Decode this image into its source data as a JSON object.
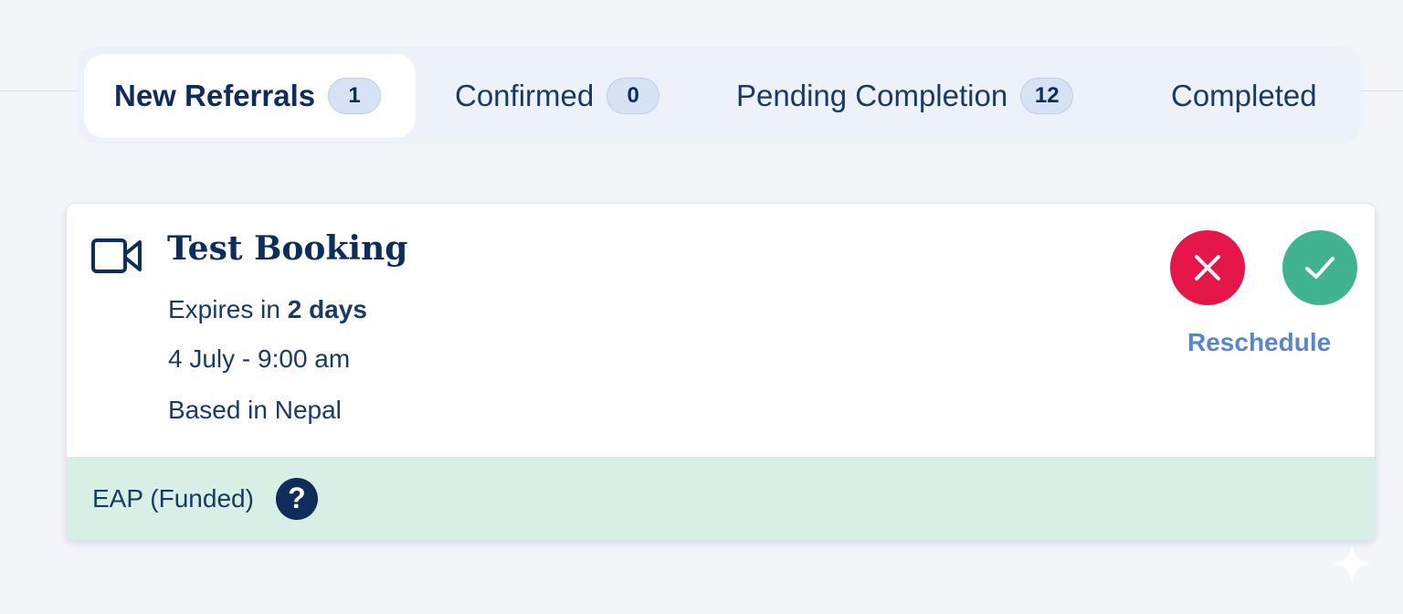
{
  "tabs": [
    {
      "label": "New Referrals",
      "count": "1",
      "active": true
    },
    {
      "label": "Confirmed",
      "count": "0",
      "active": false
    },
    {
      "label": "Pending Completion",
      "count": "12",
      "active": false
    },
    {
      "label": "Completed",
      "active": false
    }
  ],
  "booking": {
    "icon": "video-camera-icon",
    "title": "Test Booking",
    "expires_prefix": "Expires in",
    "expires_value": "2 days",
    "date_time": "4 July - 9:00 am",
    "location": "Based in Nepal",
    "funding": "EAP (Funded)",
    "help_icon": "question-mark-icon",
    "actions": {
      "decline_icon": "x-icon",
      "accept_icon": "checkmark-icon",
      "reschedule_label": "Reschedule"
    }
  },
  "colors": {
    "brand_navy": "#0f2d5a",
    "decline_red": "#e5174a",
    "accept_green": "#41b38e",
    "link_blue": "#5a86c9",
    "footer_mint": "#d8efe6",
    "badge_blue": "#d5e3f5"
  }
}
